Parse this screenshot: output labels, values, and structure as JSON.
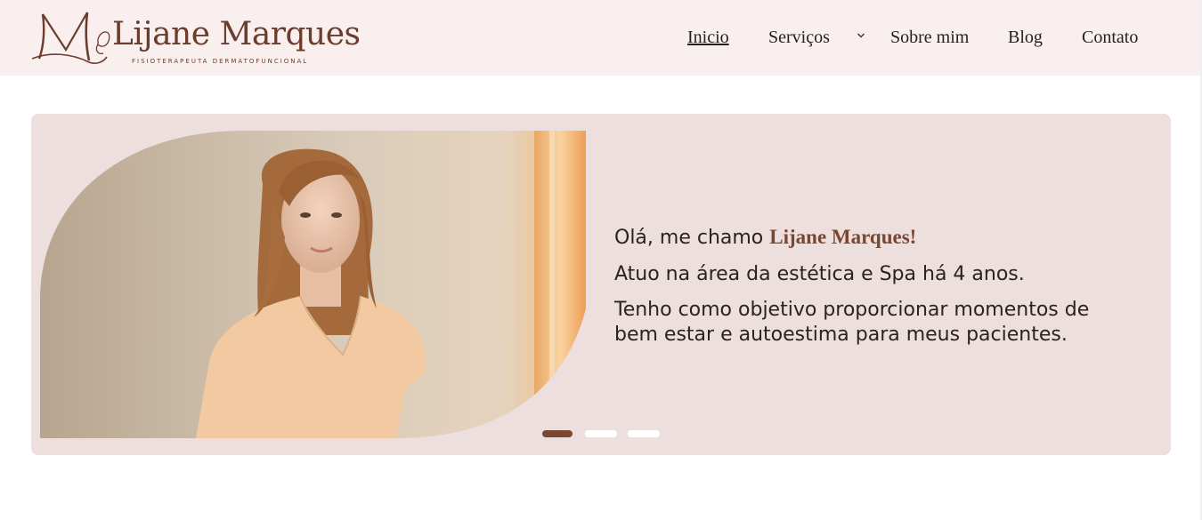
{
  "brand": {
    "name": "Lijane Marques",
    "tagline": "FISIOTERAPEUTA DERMATOFUNCIONAL",
    "monogram": "M",
    "color": "#6b3d2c"
  },
  "nav": {
    "items": [
      {
        "label": "Inicio",
        "active": true
      },
      {
        "label": "Serviços",
        "has_dropdown": true
      },
      {
        "label": "Sobre mim"
      },
      {
        "label": "Blog"
      },
      {
        "label": "Contato"
      }
    ],
    "dropdown_icon": "chevron-down-icon"
  },
  "hero": {
    "greeting_prefix": "Olá, me chamo ",
    "name": "Lijane Marques!",
    "line2": "Atuo na área da estética e Spa há 4 anos.",
    "line3": "Tenho como objetivo proporcionar momentos de bem estar e autoestima para meus pacientes.",
    "image_subject": "woman-portrait-photo",
    "background_color": "#ecdfdd",
    "accent_color": "#7a4630",
    "slides": 3,
    "active_slide": 1
  },
  "colors": {
    "header_bg": "#f9efee",
    "page_bg": "#ffffff"
  }
}
